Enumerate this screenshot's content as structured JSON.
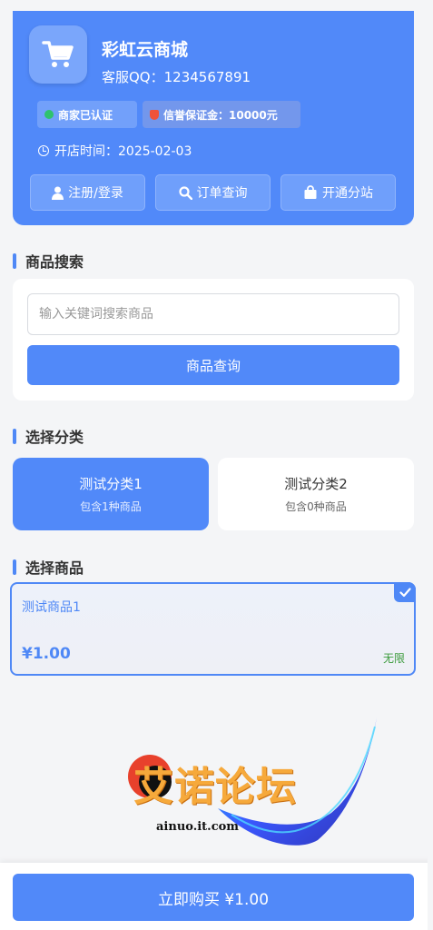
{
  "shop": {
    "name": "彩虹云商城",
    "service_qq": "客服QQ：1234567891",
    "badge_certified": "商家已认证",
    "badge_deposit": "信誉保证金：10000元",
    "open_time": "开店时间：2025-02-03",
    "actions": [
      {
        "label": "注册/登录",
        "icon": "user-icon"
      },
      {
        "label": "订单查询",
        "icon": "search-icon"
      },
      {
        "label": "开通分站",
        "icon": "shopping-bag-icon"
      }
    ],
    "accent_color": "#5189f9"
  },
  "search": {
    "title": "商品搜索",
    "placeholder": "输入关键词搜索商品",
    "button_label": "商品查询"
  },
  "categories": {
    "title": "选择分类",
    "items": [
      {
        "name": "测试分类1",
        "count": "包含1种商品",
        "selected": true
      },
      {
        "name": "测试分类2",
        "count": "包含0种商品",
        "selected": false
      }
    ]
  },
  "products": {
    "title": "选择商品",
    "items": [
      {
        "name": "测试商品1",
        "price": "¥1.00",
        "stock": "无限",
        "selected": true
      }
    ]
  },
  "watermark": {
    "text": "艾诺论坛",
    "url": "ainuo.it.com"
  },
  "footer": {
    "buy_label": "立即购买 ¥1.00"
  }
}
